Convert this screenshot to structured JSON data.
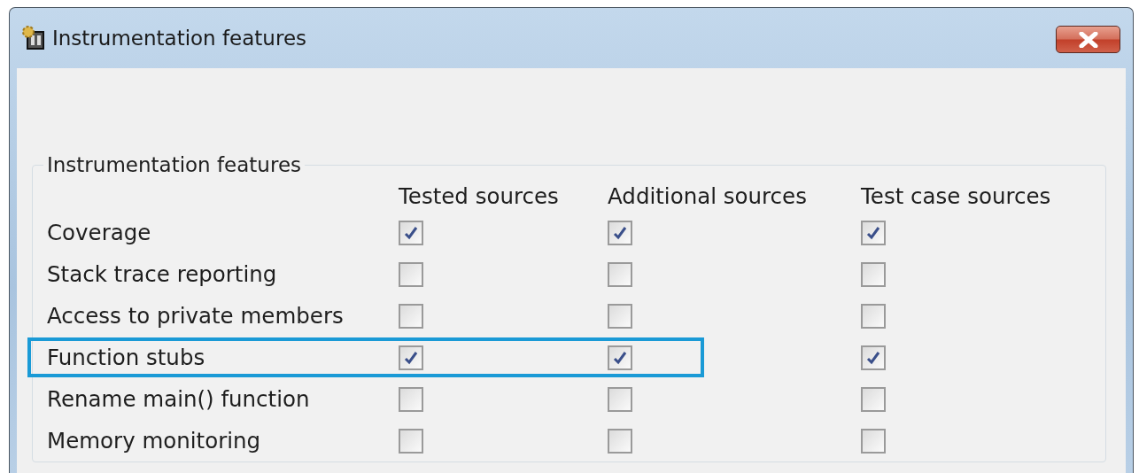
{
  "window": {
    "title": "Instrumentation features"
  },
  "group": {
    "title": "Instrumentation features",
    "columns": [
      "Tested sources",
      "Additional sources",
      "Test case sources"
    ],
    "rows": [
      {
        "label": "Coverage",
        "highlighted": false,
        "checks": [
          true,
          true,
          true
        ]
      },
      {
        "label": "Stack trace reporting",
        "highlighted": false,
        "checks": [
          false,
          false,
          false
        ]
      },
      {
        "label": "Access to private members",
        "highlighted": false,
        "checks": [
          false,
          false,
          false
        ]
      },
      {
        "label": "Function stubs",
        "highlighted": true,
        "checks": [
          true,
          true,
          true
        ]
      },
      {
        "label": "Rename main() function",
        "highlighted": false,
        "checks": [
          false,
          false,
          false
        ]
      },
      {
        "label": "Memory monitoring",
        "highlighted": false,
        "checks": [
          false,
          false,
          false
        ]
      }
    ]
  }
}
